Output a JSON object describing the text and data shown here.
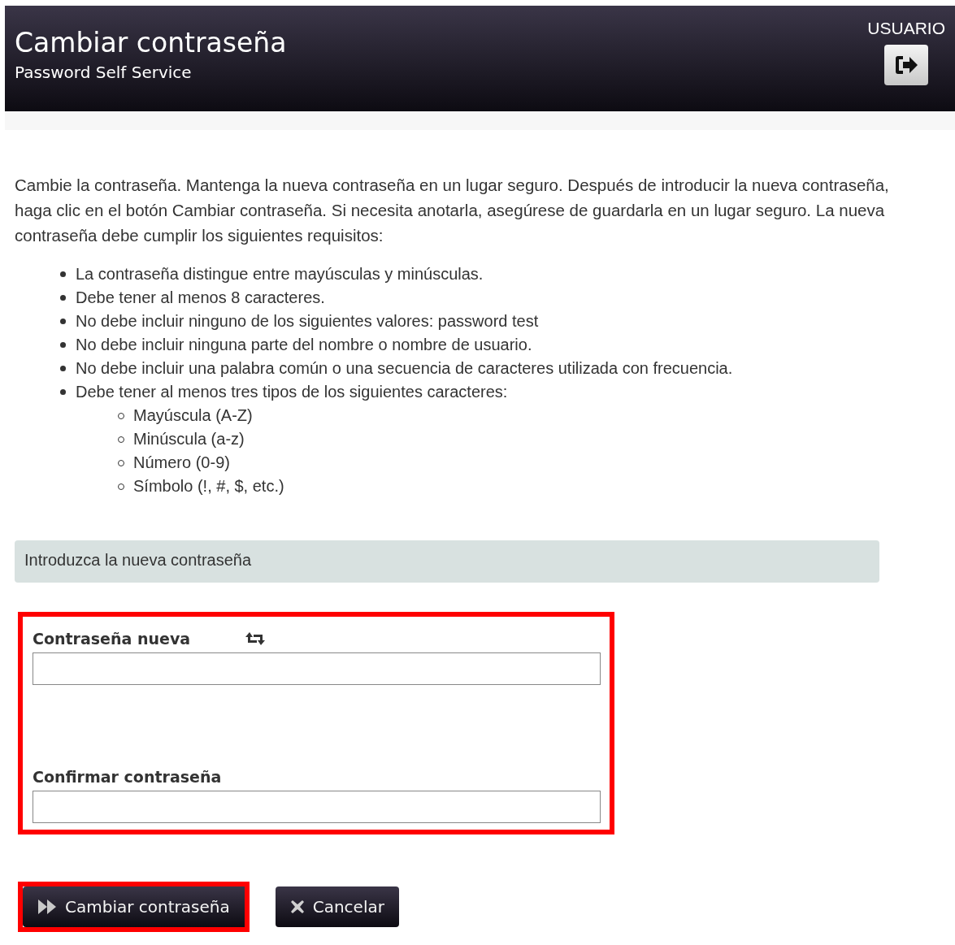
{
  "header": {
    "title": "Cambiar contraseña",
    "subtitle": "Password Self Service",
    "user": "USUARIO"
  },
  "intro": "Cambie la contraseña. Mantenga la nueva contraseña en un lugar seguro. Después de introducir la nueva contraseña, haga clic en el botón Cambiar contraseña. Si necesita anotarla, asegúrese de guardarla en un lugar seguro. La nueva contraseña debe cumplir los siguientes requisitos:",
  "requirements": [
    {
      "text": "La contraseña distingue entre mayúsculas y minúsculas."
    },
    {
      "text": "Debe tener al menos 8 caracteres."
    },
    {
      "text": "No debe incluir ninguno de los siguientes valores: password test"
    },
    {
      "text": "No debe incluir ninguna parte del nombre o nombre de usuario."
    },
    {
      "text": "No debe incluir una palabra común o una secuencia de caracteres utilizada con frecuencia."
    },
    {
      "text": "Debe tener al menos tres tipos de los siguientes caracteres:",
      "children": [
        {
          "text": "Mayúscula (A-Z)"
        },
        {
          "text": "Minúscula (a-z)"
        },
        {
          "text": "Número (0-9)"
        },
        {
          "text": "Símbolo (!, #, $, etc.)"
        }
      ]
    }
  ],
  "section_title": "Introduzca la nueva contraseña",
  "fields": {
    "highlighted": true,
    "items": [
      {
        "label": "Contraseña nueva",
        "kind": "generate"
      },
      {
        "label": "Confirmar contraseña",
        "kind": "plain"
      }
    ]
  },
  "buttons": [
    {
      "label": "Cambiar contraseña",
      "kind": "submit",
      "highlighted": true
    },
    {
      "label": "Cancelar",
      "kind": "cancel",
      "highlighted": false
    }
  ]
}
